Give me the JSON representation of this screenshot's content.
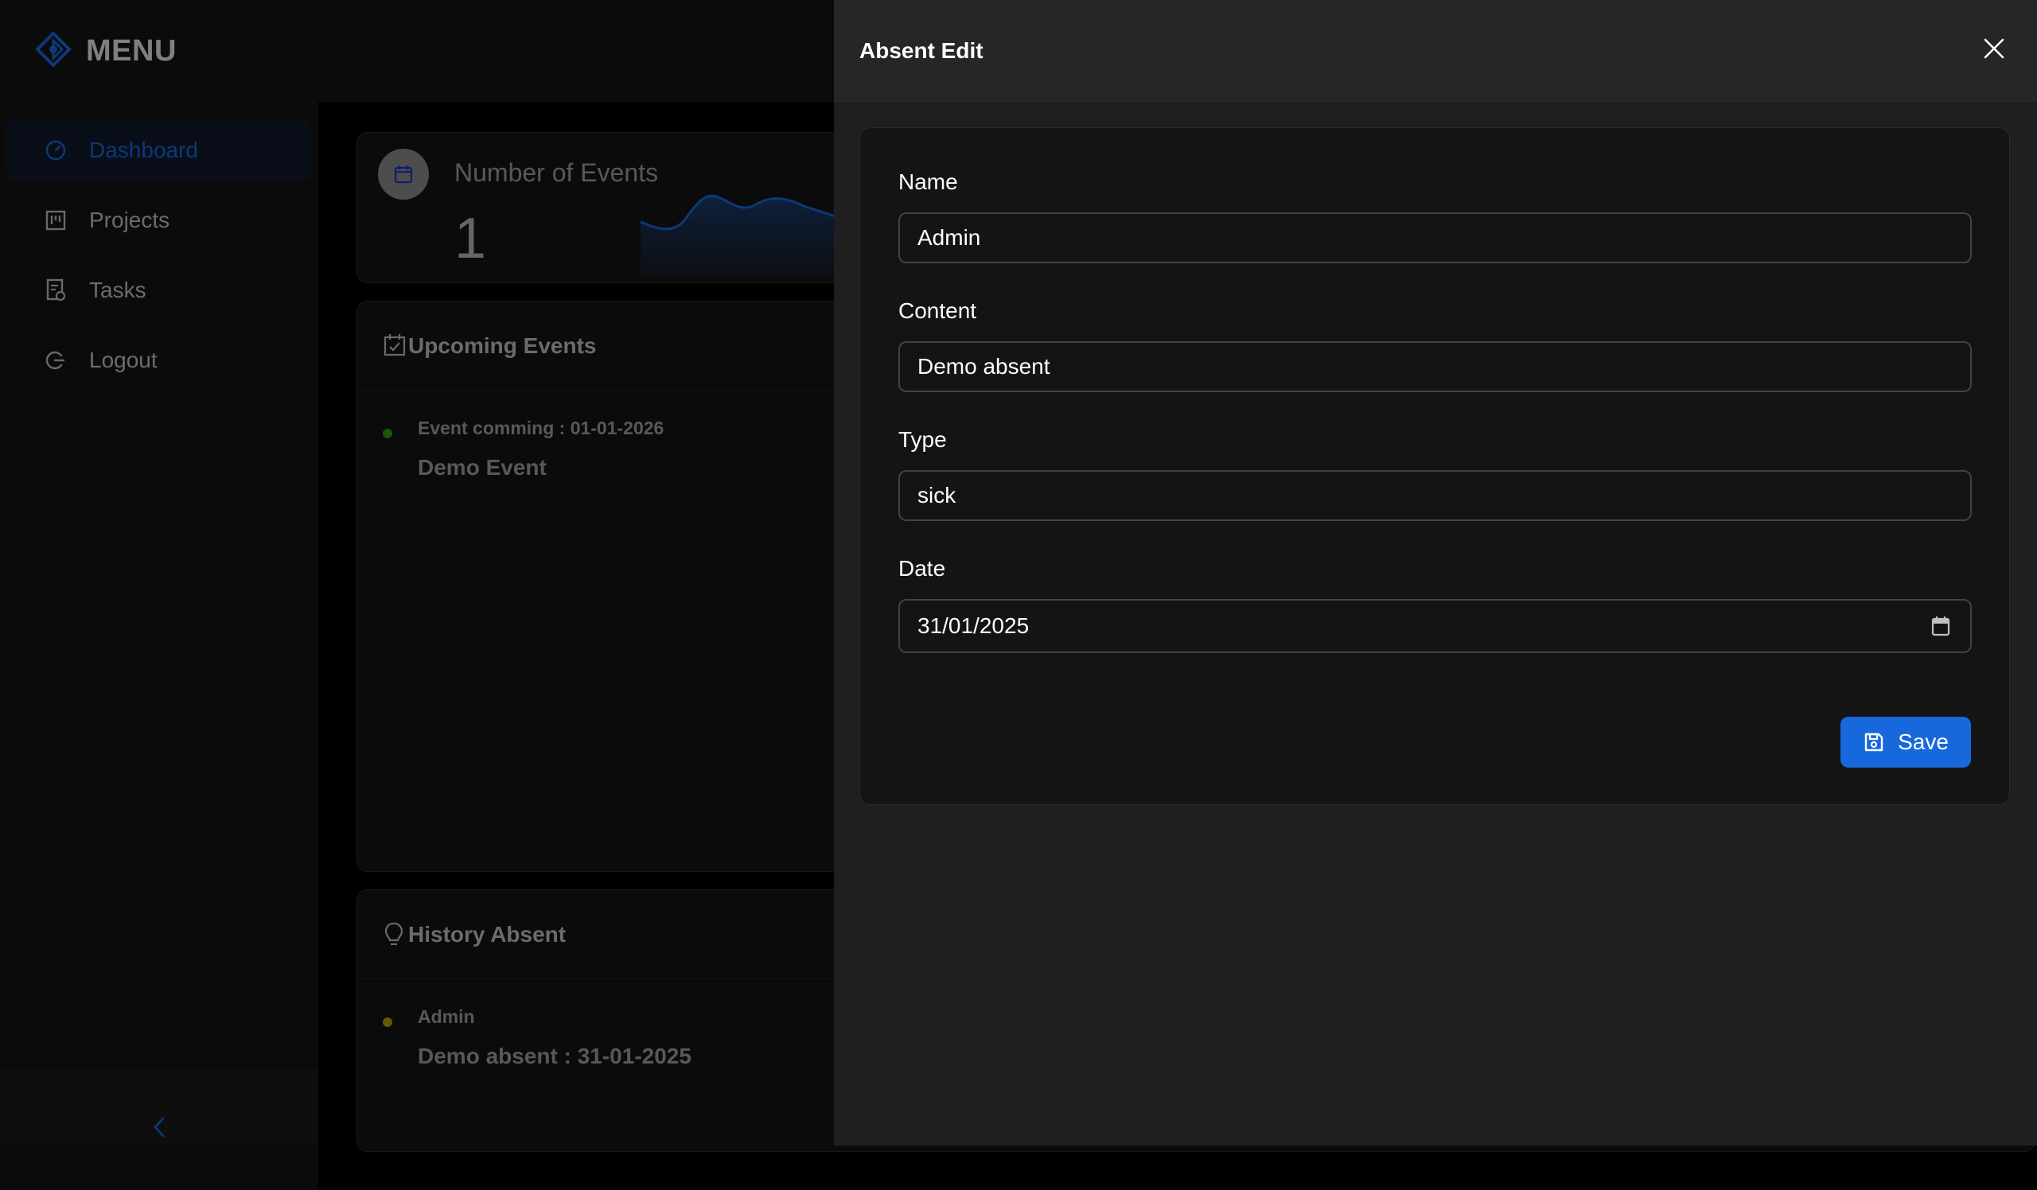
{
  "app": {
    "logo_text": "MENU",
    "menu": [
      {
        "label": "Dashboard",
        "icon": "dashboard-icon",
        "active": true
      },
      {
        "label": "Projects",
        "icon": "project-icon",
        "active": false
      },
      {
        "label": "Tasks",
        "icon": "task-icon",
        "active": false
      },
      {
        "label": "Logout",
        "icon": "logout-icon",
        "active": false
      }
    ],
    "collapse_icon": "chevron-left-icon",
    "accent_color": "#1668dc"
  },
  "stats": {
    "title": "Number of Events",
    "value": "1",
    "icon": "calendar-icon"
  },
  "upcoming": {
    "title": "Upcoming Events",
    "icon": "calendar-check-icon",
    "items": [
      {
        "title": "Event comming : 01-01-2026",
        "desc": "Demo Event",
        "dot_color": "#389e0d"
      }
    ]
  },
  "history": {
    "title": "History Absent",
    "icon": "bulb-icon",
    "items": [
      {
        "title": "Admin",
        "desc": "Demo absent : 31-01-2025",
        "dot_color": "#b8a000"
      }
    ]
  },
  "drawer": {
    "title": "Absent Edit",
    "close_icon": "close-icon",
    "fields": {
      "name": {
        "label": "Name",
        "value": "Admin"
      },
      "content": {
        "label": "Content",
        "value": "Demo absent"
      },
      "type": {
        "label": "Type",
        "value": "sick"
      },
      "date": {
        "label": "Date",
        "value": "31/01/2025"
      }
    },
    "save_label": "Save",
    "save_icon": "save-icon"
  }
}
